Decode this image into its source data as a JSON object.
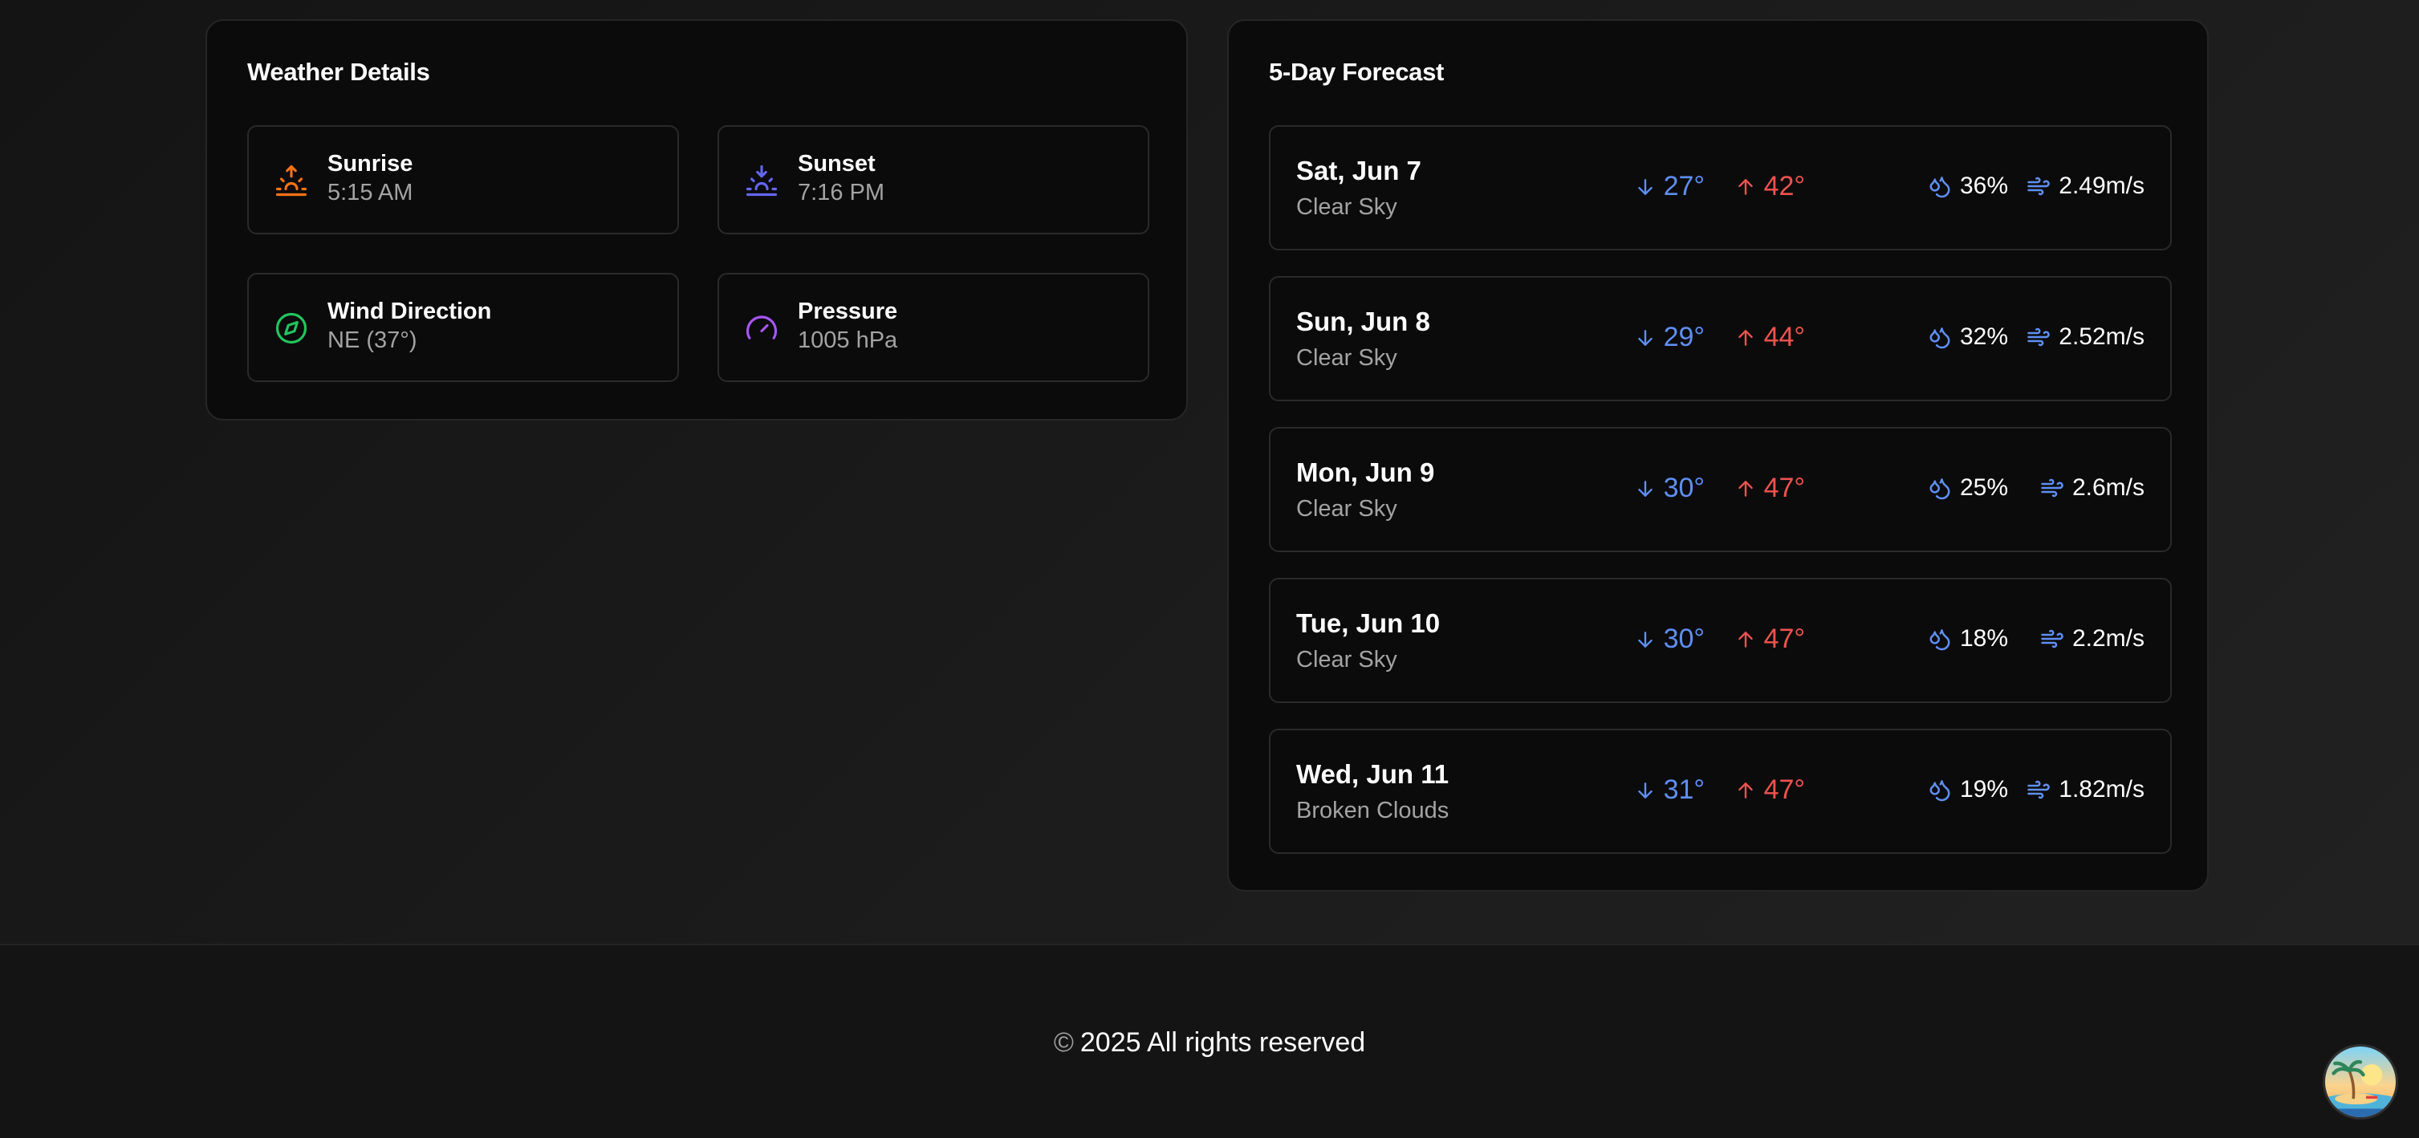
{
  "weather_details": {
    "title": "Weather Details",
    "tiles": [
      {
        "label": "Sunrise",
        "value": "5:15 AM",
        "icon": "sunrise-icon",
        "color": "#f97316"
      },
      {
        "label": "Sunset",
        "value": "7:16 PM",
        "icon": "sunset-icon",
        "color": "#6366f1"
      },
      {
        "label": "Wind Direction",
        "value": "NE (37°)",
        "icon": "compass-icon",
        "color": "#22c55e"
      },
      {
        "label": "Pressure",
        "value": "1005 hPa",
        "icon": "gauge-icon",
        "color": "#a855f7"
      }
    ]
  },
  "forecast": {
    "title": "5-Day Forecast",
    "days": [
      {
        "day": "Sat, Jun 7",
        "desc": "Clear Sky",
        "low": "27°",
        "high": "42°",
        "humidity": "36%",
        "wind": "2.49m/s"
      },
      {
        "day": "Sun, Jun 8",
        "desc": "Clear Sky",
        "low": "29°",
        "high": "44°",
        "humidity": "32%",
        "wind": "2.52m/s"
      },
      {
        "day": "Mon, Jun 9",
        "desc": "Clear Sky",
        "low": "30°",
        "high": "47°",
        "humidity": "25%",
        "wind": "2.6m/s"
      },
      {
        "day": "Tue, Jun 10",
        "desc": "Clear Sky",
        "low": "30°",
        "high": "47°",
        "humidity": "18%",
        "wind": "2.2m/s"
      },
      {
        "day": "Wed, Jun 11",
        "desc": "Broken Clouds",
        "low": "31°",
        "high": "47°",
        "humidity": "19%",
        "wind": "1.82m/s"
      }
    ],
    "colors": {
      "low": "#5f8ff2",
      "high": "#ef5350",
      "humidity_icon": "#5f8ff2",
      "wind_icon": "#5f8ff2"
    }
  },
  "footer": {
    "copyright_symbol": "©",
    "text": "2025 All rights reserved"
  },
  "avatar": {
    "icon": "beach-island-avatar"
  }
}
